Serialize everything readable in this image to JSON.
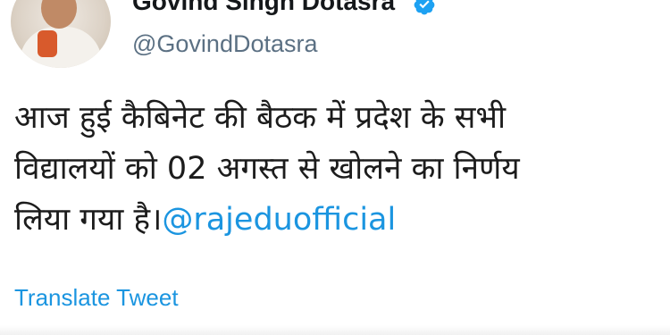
{
  "user": {
    "display_name": "Govind Singh Dotasra",
    "handle": "@GovindDotasra",
    "verified_icon": "verified-badge-icon",
    "avatar_icon": "profile-photo"
  },
  "tweet": {
    "text_line1": "आज हुई कैबिनेट की बैठक में प्रदेश के सभी",
    "text_line2": "विद्यालयों को 02 अगस्त से खोलने का निर्णय",
    "text_line3": "लिया गया है।",
    "mention": "@rajeduofficial"
  },
  "actions": {
    "translate_label": "Translate Tweet"
  },
  "colors": {
    "link": "#1b95e0",
    "handle": "#5b7083",
    "text": "#1c1c1c"
  }
}
